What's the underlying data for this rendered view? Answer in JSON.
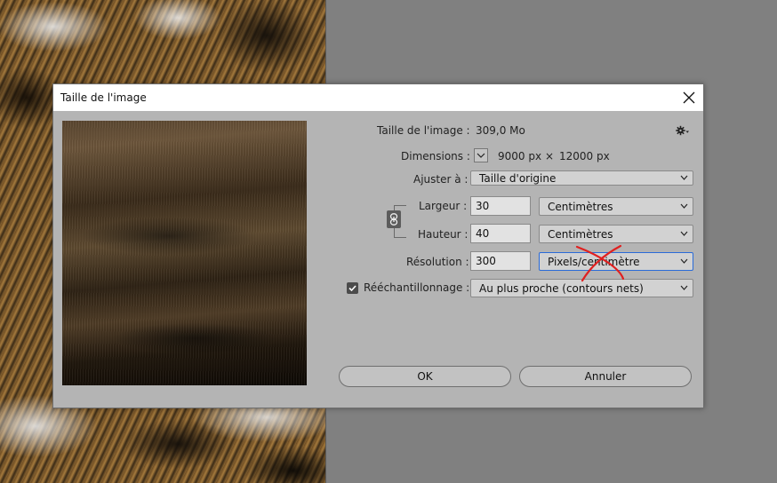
{
  "window": {
    "title": "Taille de l'image"
  },
  "info": {
    "size_label": "Taille de l'image :",
    "size_value": "309,0 Mo",
    "dimensions_label": "Dimensions :",
    "dim_width": "9000 px",
    "dim_times": "×",
    "dim_height": "12000 px"
  },
  "fit": {
    "label": "Ajuster à :",
    "value": "Taille d'origine"
  },
  "width": {
    "label": "Largeur :",
    "value": "30",
    "unit": "Centimètres"
  },
  "height": {
    "label": "Hauteur :",
    "value": "40",
    "unit": "Centimètres"
  },
  "resolution": {
    "label": "Résolution :",
    "value": "300",
    "unit": "Pixels/centimètre"
  },
  "resample": {
    "label": "Rééchantillonnage :",
    "checked": true,
    "value": "Au plus proche (contours nets)"
  },
  "buttons": {
    "ok": "OK",
    "cancel": "Annuler"
  },
  "icons": {
    "close": "close-icon",
    "gear": "gear-icon",
    "dimensions_toggle": "chevron-down-icon",
    "link": "chain-link-icon",
    "check": "checkmark-icon",
    "annotation": "red-x-mark"
  },
  "colors": {
    "focus_border": "#2a6bd8",
    "annotation_red": "#e02020"
  }
}
